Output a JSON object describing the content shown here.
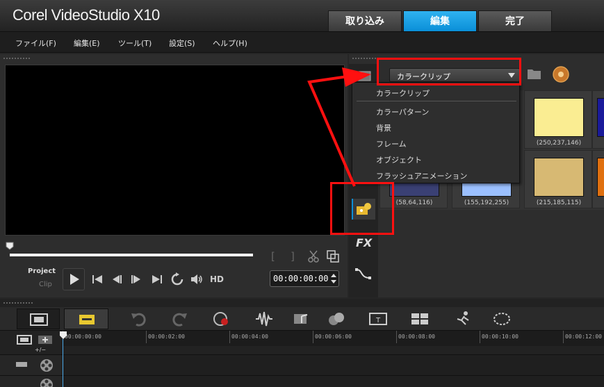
{
  "app": {
    "title": "Corel VideoStudio X10"
  },
  "steps": [
    {
      "label": "取り込み",
      "active": false
    },
    {
      "label": "編集",
      "active": true
    },
    {
      "label": "完了",
      "active": false
    }
  ],
  "menu": [
    {
      "label": "ファイル(F)"
    },
    {
      "label": "編集(E)"
    },
    {
      "label": "ツール(T)"
    },
    {
      "label": "設定(S)"
    },
    {
      "label": "ヘルプ(H)"
    }
  ],
  "player": {
    "mode_project": "Project",
    "mode_clip": "Clip",
    "timecode": "00:00:00:00",
    "hd_label": "HD",
    "mark_in": "[",
    "mark_out": "]"
  },
  "library": {
    "selected_category": "カラークリップ",
    "dropdown_options": [
      {
        "label": "カラークリップ"
      },
      {
        "label": "カラーパターン"
      },
      {
        "label": "背景"
      },
      {
        "label": "フレーム"
      },
      {
        "label": "オブジェクト"
      },
      {
        "label": "フラッシュアニメーション"
      }
    ],
    "swatches": [
      {
        "label": "(250,237,146)",
        "color": "#faed92"
      },
      {
        "label": "",
        "color": "#1a1a9a"
      },
      {
        "label": "(58,64,116)",
        "color": "#3a4074"
      },
      {
        "label": "(155,192,255)",
        "color": "#9bc0ff"
      },
      {
        "label": "(215,185,115)",
        "color": "#d7b973"
      },
      {
        "label": "",
        "color": "#e07010"
      }
    ],
    "fx_label": "FX"
  },
  "timeline": {
    "ticks": [
      {
        "label": "00:00:00:00"
      },
      {
        "label": "00:00:02:00"
      },
      {
        "label": "00:00:04:00"
      },
      {
        "label": "00:00:06:00"
      },
      {
        "label": "00:00:08:00"
      },
      {
        "label": "00:00:10:00"
      },
      {
        "label": "00:00:12:00"
      }
    ],
    "add_remove_label": "+/−"
  },
  "colors": {
    "accent": "#0a8fd8",
    "annotation": "#ff1010"
  }
}
